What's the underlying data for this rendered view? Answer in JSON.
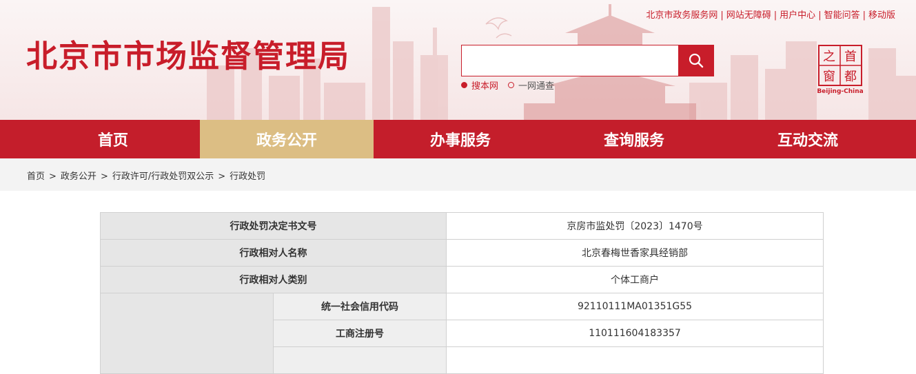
{
  "site": {
    "title": "北京市市场监督管理局"
  },
  "top_links": [
    "北京市政务服务网",
    "网站无障碍",
    "用户中心",
    "智能问答",
    "移动版"
  ],
  "search": {
    "placeholder": "",
    "options": [
      {
        "label": "搜本网",
        "selected": true
      },
      {
        "label": "一网通查",
        "selected": false
      }
    ]
  },
  "logo": {
    "chars": [
      "首",
      "都",
      "之",
      "窗"
    ],
    "caption": "Beijing-China"
  },
  "nav": {
    "items": [
      {
        "label": "首页",
        "active": false
      },
      {
        "label": "政务公开",
        "active": true
      },
      {
        "label": "办事服务",
        "active": false
      },
      {
        "label": "查询服务",
        "active": false
      },
      {
        "label": "互动交流",
        "active": false
      }
    ]
  },
  "breadcrumb": [
    "首页",
    "政务公开",
    "行政许可/行政处罚双公示",
    "行政处罚"
  ],
  "table": {
    "rows": [
      {
        "label": "行政处罚决定书文号",
        "value": "京房市监处罚〔2023〕1470号"
      },
      {
        "label": "行政相对人名称",
        "value": "北京春梅世香家具经销部"
      },
      {
        "label": "行政相对人类别",
        "value": "个体工商户"
      }
    ],
    "sub_rows": [
      {
        "label": "统一社会信用代码",
        "value": "92110111MA01351G55"
      },
      {
        "label": "工商注册号",
        "value": "110111604183357"
      },
      {
        "label": "",
        "value": ""
      }
    ]
  },
  "colors": {
    "brand_red": "#c81d2a",
    "nav_active": "#dcbe84"
  }
}
